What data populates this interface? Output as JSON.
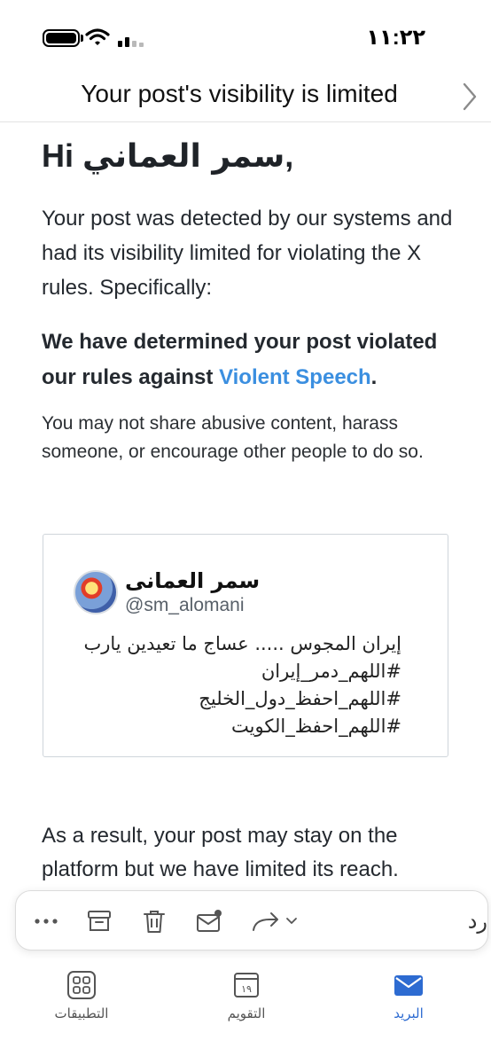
{
  "status_bar": {
    "time": "١١:٢٢"
  },
  "email": {
    "subject": "Your post's visibility is limited",
    "greeting_prefix": "Hi ",
    "greeting_name": "سمر العماني",
    "greeting_suffix": ",",
    "intro": "Your post was detected by our systems and had its visibility limited for violating the X rules. Specifically:",
    "determination_prefix": "We have determined your post violated our rules against ",
    "determination_link": "Violent Speech",
    "determination_suffix": ".",
    "rule_description": "You may not share abusive content, harass someone, or encourage other people to do so.",
    "tweet": {
      "author_name": "سمر العمانى",
      "handle": "@sm_alomani",
      "text_line1": "إيران المجوس ..... عساج ما تعيدين يارب",
      "text_line2": "#اللهم_دمر_إيران #اللهم_احفظ_دول_الخليج",
      "text_line3": "#اللهم_احفظ_الكويت"
    },
    "result": "As a result, your post may stay on the platform but we have limited its reach."
  },
  "toolbar": {
    "reply_label": "رد",
    "icons": [
      "more-icon",
      "archive-icon",
      "delete-icon",
      "mark-unread-icon",
      "forward-icon"
    ]
  },
  "tabs": {
    "apps_label": "التطبيقات",
    "calendar_label": "التقويم",
    "calendar_day": "١٩",
    "mail_label": "البريد"
  },
  "colors": {
    "link": "#3b8fe0",
    "active_tab": "#2d6bd1"
  }
}
